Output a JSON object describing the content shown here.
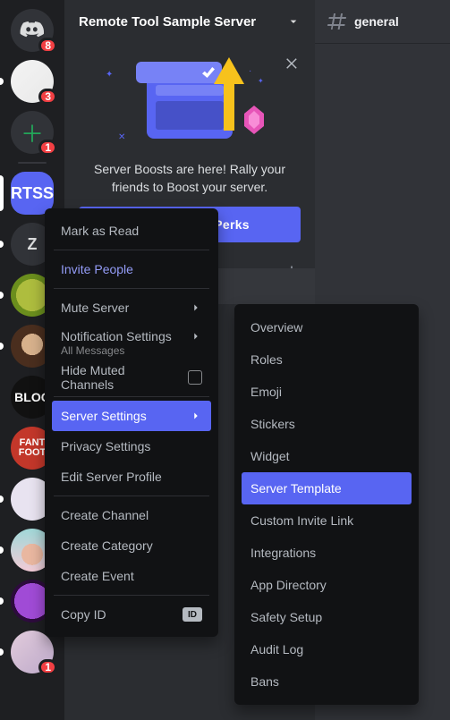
{
  "rail": {
    "discord_badge": "8",
    "avatar1_badge": "3",
    "add_badge": "1",
    "active_initials": "RTSS",
    "letter_server": "Z",
    "bloc_label": "BLOC",
    "foot_label": "FANT FOOT",
    "last_badge": "1"
  },
  "header": {
    "server_name": "Remote Tool Sample Server"
  },
  "boost": {
    "text": "Server Boosts are here! Rally your friends to Boost your server.",
    "button": "See Levels & Perks"
  },
  "channel": {
    "name": "general"
  },
  "menu": {
    "mark_read": "Mark as Read",
    "invite": "Invite People",
    "mute": "Mute Server",
    "notif": "Notification Settings",
    "notif_sub": "All Messages",
    "hide_muted": "Hide Muted Channels",
    "server_settings": "Server Settings",
    "privacy": "Privacy Settings",
    "edit_profile": "Edit Server Profile",
    "create_channel": "Create Channel",
    "create_category": "Create Category",
    "create_event": "Create Event",
    "copy_id": "Copy ID",
    "id_pill": "ID"
  },
  "submenu": {
    "overview": "Overview",
    "roles": "Roles",
    "emoji": "Emoji",
    "stickers": "Stickers",
    "widget": "Widget",
    "server_template": "Server Template",
    "custom_invite": "Custom Invite Link",
    "integrations": "Integrations",
    "app_directory": "App Directory",
    "safety_setup": "Safety Setup",
    "audit_log": "Audit Log",
    "bans": "Bans"
  }
}
